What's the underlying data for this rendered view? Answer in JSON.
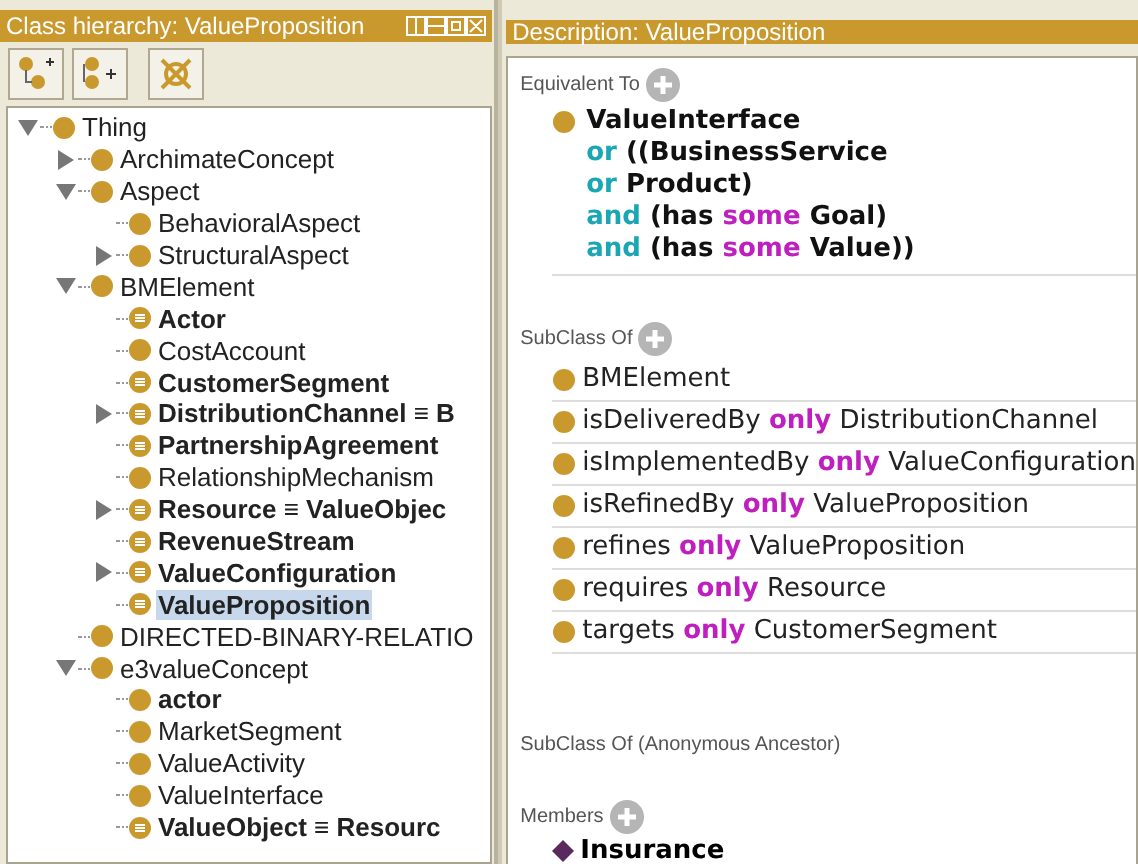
{
  "hierarchy": {
    "title": "Class hierarchy: ValueProposition",
    "tree": [
      {
        "label": "Thing",
        "defined": false,
        "bold": false,
        "expanded": true,
        "selected": false,
        "children": [
          {
            "label": "ArchimateConcept",
            "defined": false,
            "bold": false,
            "expanded": false,
            "selected": false
          },
          {
            "label": "Aspect",
            "defined": false,
            "bold": false,
            "expanded": true,
            "selected": false,
            "children": [
              {
                "label": "BehavioralAspect",
                "defined": false,
                "bold": false,
                "selected": false
              },
              {
                "label": "StructuralAspect",
                "defined": false,
                "bold": false,
                "expanded": false,
                "selected": false
              }
            ]
          },
          {
            "label": "BMElement",
            "defined": false,
            "bold": false,
            "expanded": true,
            "selected": false,
            "children": [
              {
                "label": "Actor",
                "defined": true,
                "bold": true,
                "selected": false
              },
              {
                "label": "CostAccount",
                "defined": false,
                "bold": false,
                "selected": false
              },
              {
                "label": "CustomerSegment",
                "defined": true,
                "bold": true,
                "selected": false
              },
              {
                "label": "DistributionChannel ≡ B",
                "defined": true,
                "bold": true,
                "expanded": false,
                "selected": false
              },
              {
                "label": "PartnershipAgreement",
                "defined": true,
                "bold": true,
                "selected": false
              },
              {
                "label": "RelationshipMechanism",
                "defined": false,
                "bold": false,
                "selected": false
              },
              {
                "label": "Resource ≡ ValueObjec",
                "defined": true,
                "bold": true,
                "expanded": false,
                "selected": false
              },
              {
                "label": "RevenueStream",
                "defined": true,
                "bold": true,
                "selected": false
              },
              {
                "label": "ValueConfiguration",
                "defined": true,
                "bold": true,
                "expanded": false,
                "selected": false
              },
              {
                "label": "ValueProposition",
                "defined": true,
                "bold": true,
                "selected": true
              }
            ]
          },
          {
            "label": "DIRECTED-BINARY-RELATIO",
            "defined": false,
            "bold": false,
            "selected": false
          },
          {
            "label": "e3valueConcept",
            "defined": false,
            "bold": false,
            "expanded": true,
            "selected": false,
            "children": [
              {
                "label": "actor",
                "defined": false,
                "bold": true,
                "selected": false
              },
              {
                "label": "MarketSegment",
                "defined": false,
                "bold": false,
                "selected": false
              },
              {
                "label": "ValueActivity",
                "defined": false,
                "bold": false,
                "selected": false
              },
              {
                "label": "ValueInterface",
                "defined": false,
                "bold": false,
                "selected": false
              },
              {
                "label": "ValueObject ≡ Resourc",
                "defined": true,
                "bold": true,
                "selected": false
              }
            ]
          }
        ]
      }
    ]
  },
  "description": {
    "title": "Description: ValueProposition",
    "equivalent_to": {
      "label": "Equivalent To",
      "lines": [
        [
          {
            "text": "ValueInterface",
            "kind": "name"
          }
        ],
        [
          {
            "text": "or",
            "kind": "connective"
          },
          {
            "text": "((BusinessService",
            "kind": "name"
          }
        ],
        [
          {
            "text": "or",
            "kind": "connective"
          },
          {
            "text": "Product)",
            "kind": "name"
          }
        ],
        [
          {
            "text": "and",
            "kind": "connective"
          },
          {
            "text": "(has",
            "kind": "name"
          },
          {
            "text": "some",
            "kind": "quantifier"
          },
          {
            "text": "Goal)",
            "kind": "name"
          }
        ],
        [
          {
            "text": "and",
            "kind": "connective"
          },
          {
            "text": "(has",
            "kind": "name"
          },
          {
            "text": "some",
            "kind": "quantifier"
          },
          {
            "text": "Value))",
            "kind": "name"
          }
        ]
      ]
    },
    "subclass_of": {
      "label": "SubClass Of",
      "rows": [
        [
          {
            "text": "BMElement",
            "kind": "plain"
          }
        ],
        [
          {
            "text": "isDeliveredBy",
            "kind": "plain"
          },
          {
            "text": "only",
            "kind": "quantifier"
          },
          {
            "text": "DistributionChannel",
            "kind": "plain"
          }
        ],
        [
          {
            "text": "isImplementedBy",
            "kind": "plain"
          },
          {
            "text": "only",
            "kind": "quantifier"
          },
          {
            "text": "ValueConfiguration",
            "kind": "plain"
          }
        ],
        [
          {
            "text": "isRefinedBy",
            "kind": "plain"
          },
          {
            "text": "only",
            "kind": "quantifier"
          },
          {
            "text": "ValueProposition",
            "kind": "plain"
          }
        ],
        [
          {
            "text": "refines",
            "kind": "plain"
          },
          {
            "text": "only",
            "kind": "quantifier"
          },
          {
            "text": "ValueProposition",
            "kind": "plain"
          }
        ],
        [
          {
            "text": "requires",
            "kind": "plain"
          },
          {
            "text": "only",
            "kind": "quantifier"
          },
          {
            "text": "Resource",
            "kind": "plain"
          }
        ],
        [
          {
            "text": "targets",
            "kind": "plain"
          },
          {
            "text": "only",
            "kind": "quantifier"
          },
          {
            "text": "CustomerSegment",
            "kind": "plain"
          }
        ]
      ]
    },
    "anonymous_ancestor": {
      "label": "SubClass Of (Anonymous Ancestor)"
    },
    "members": {
      "label": "Members",
      "items": [
        "Insurance"
      ]
    }
  }
}
